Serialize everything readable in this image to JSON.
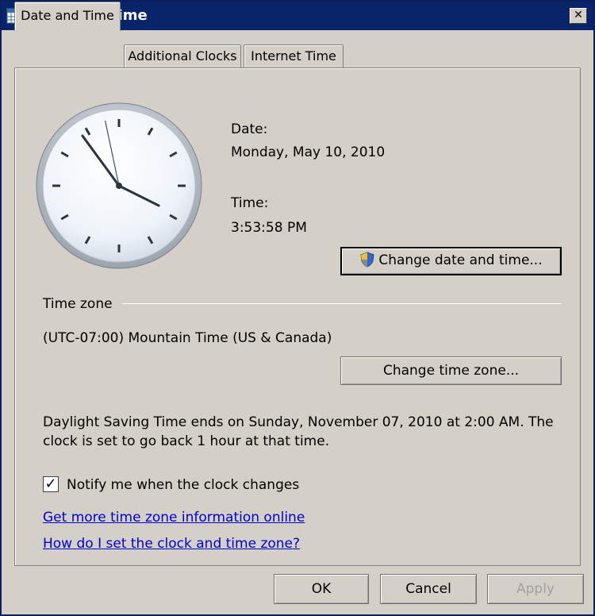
{
  "window": {
    "title": "Date and Time"
  },
  "tabs": [
    {
      "label": "Date and Time"
    },
    {
      "label": "Additional Clocks"
    },
    {
      "label": "Internet Time"
    }
  ],
  "clock": {
    "hours": 3,
    "minutes": 53,
    "seconds": 58
  },
  "date": {
    "label": "Date:",
    "value": "Monday, May 10, 2010"
  },
  "time": {
    "label": "Time:",
    "value": "3:53:58 PM"
  },
  "buttons": {
    "change_date_time": "Change date and time...",
    "change_time_zone": "Change time zone...",
    "ok": "OK",
    "cancel": "Cancel",
    "apply": "Apply"
  },
  "timezone": {
    "section_label": "Time zone",
    "value": "(UTC-07:00) Mountain Time (US & Canada)"
  },
  "dst": {
    "line1": "Daylight Saving Time ends on Sunday, November 07, 2010 at 2:00 AM. The",
    "line2": "clock is set to go back 1 hour at that time."
  },
  "notify": {
    "label": "Notify me when the clock changes",
    "checked": true
  },
  "links": {
    "more_info": "Get more time zone information online",
    "how_to": "How do I set the clock and time zone?"
  }
}
